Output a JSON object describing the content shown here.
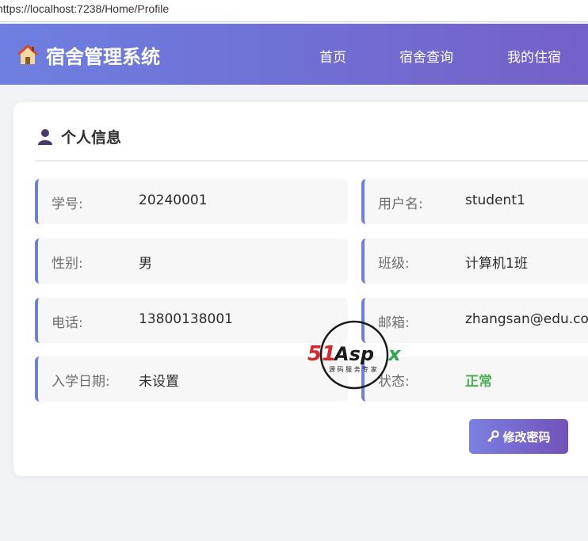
{
  "browser": {
    "url": "https://localhost:7238/Home/Profile"
  },
  "navbar": {
    "brand_icon": "house-icon",
    "title": "宿舍管理系统",
    "links": [
      {
        "label": "首页"
      },
      {
        "label": "宿舍查询"
      },
      {
        "label": "我的住宿"
      }
    ],
    "colors": {
      "gradient_start": "#6d7fe0",
      "gradient_end": "#7460c8"
    }
  },
  "profile": {
    "header_icon": "user-icon",
    "title": "个人信息",
    "fields": [
      {
        "label": "学号:",
        "value": "20240001"
      },
      {
        "label": "用户名:",
        "value": "student1"
      },
      {
        "label": "性别:",
        "value": "男"
      },
      {
        "label": "班级:",
        "value": "计算机1班"
      },
      {
        "label": "电话:",
        "value": "13800138001"
      },
      {
        "label": "邮箱:",
        "value": "zhangsan@edu.com"
      },
      {
        "label": "入学日期:",
        "value": "未设置"
      },
      {
        "label": "状态:",
        "value": "正常"
      }
    ],
    "status_color": "#4caf50",
    "accent_color": "#6f7fd8"
  },
  "actions": {
    "change_password_icon": "key-icon",
    "change_password_label": "修改密码"
  },
  "watermark": {
    "brand": "51Aspx",
    "tagline": "源码服务专家"
  }
}
